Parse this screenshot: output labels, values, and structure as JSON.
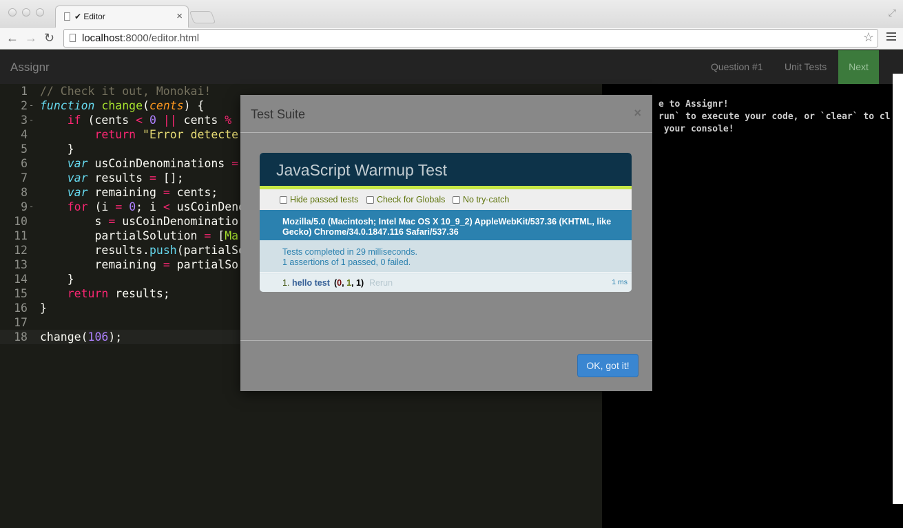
{
  "browser": {
    "tab_title": "✔ Editor",
    "tab_close": "×",
    "url_host": "localhost",
    "url_path": ":8000/editor.html",
    "icons": [
      "back-icon",
      "forward-icon",
      "reload-icon",
      "star-icon",
      "menu-icon"
    ]
  },
  "navbar": {
    "brand": "Assignr",
    "links": [
      "Question #1",
      "Unit Tests"
    ],
    "next_label": "Next"
  },
  "editor": {
    "lines": [
      {
        "n": "1",
        "fold": "",
        "html": "<span class=\"c-comment\">// Check it out, Monokai!</span>"
      },
      {
        "n": "2",
        "fold": "-",
        "html": "<span class=\"c-kw\">function</span> <span class=\"c-fn\">change</span>(<span class=\"c-param\">cents</span>) {"
      },
      {
        "n": "3",
        "fold": "-",
        "html": "    <span class=\"c-ctrl\">if</span> (cents <span class=\"c-op\">&lt;</span> <span class=\"c-num\">0</span> <span class=\"c-op\">||</span> cents <span class=\"c-op\">%</span>"
      },
      {
        "n": "4",
        "fold": "",
        "html": "        <span class=\"c-ctrl\">return</span> <span class=\"c-str\">\"Error detecte</span>"
      },
      {
        "n": "5",
        "fold": "",
        "html": "    }"
      },
      {
        "n": "6",
        "fold": "",
        "html": "    <span class=\"c-kw\">var</span> usCoinDenominations <span class=\"c-op\">=</span>"
      },
      {
        "n": "7",
        "fold": "",
        "html": "    <span class=\"c-kw\">var</span> results <span class=\"c-op\">=</span> [];"
      },
      {
        "n": "8",
        "fold": "",
        "html": "    <span class=\"c-kw\">var</span> remaining <span class=\"c-op\">=</span> cents;"
      },
      {
        "n": "9",
        "fold": "-",
        "html": "    <span class=\"c-ctrl\">for</span> (i <span class=\"c-op\">=</span> <span class=\"c-num\">0</span>; i <span class=\"c-op\">&lt;</span> usCoinDeno"
      },
      {
        "n": "10",
        "fold": "",
        "html": "        s <span class=\"c-op\">=</span> usCoinDenominatio"
      },
      {
        "n": "11",
        "fold": "",
        "html": "        partialSolution <span class=\"c-op\">=</span> [<span class=\"c-fn\">Ma</span>"
      },
      {
        "n": "12",
        "fold": "",
        "html": "        results.<span class=\"c-kw\" style=\"font-style:normal\">push</span>(partialSo"
      },
      {
        "n": "13",
        "fold": "",
        "html": "        remaining <span class=\"c-op\">=</span> partialSo"
      },
      {
        "n": "14",
        "fold": "",
        "html": "    }"
      },
      {
        "n": "15",
        "fold": "",
        "html": "    <span class=\"c-ctrl\">return</span> results;"
      },
      {
        "n": "16",
        "fold": "",
        "html": "}"
      },
      {
        "n": "17",
        "fold": "",
        "html": ""
      },
      {
        "n": "18",
        "fold": "",
        "html": "change(<span class=\"c-num\">106</span>);"
      }
    ]
  },
  "console": {
    "lines": [
      "e to Assignr!",
      "run` to execute your code, or `clear` to cl",
      " your console!"
    ]
  },
  "modal": {
    "title": "Test Suite",
    "close": "×",
    "ok_label": "OK, got it!",
    "qunit": {
      "header": "JavaScript Warmup Test",
      "options": [
        "Hide passed tests",
        "Check for Globals",
        "No try-catch"
      ],
      "user_agent": "Mozilla/5.0 (Macintosh; Intel Mac OS X 10_9_2) AppleWebKit/537.36 (KHTML, like Gecko) Chrome/34.0.1847.116 Safari/537.36",
      "result_line1": "Tests completed in 29 milliseconds.",
      "result_line2": "1 assertions of 1 passed, 0 failed.",
      "test": {
        "number": "1.",
        "name": "hello test",
        "failed": "0",
        "passed": "1",
        "total": "1",
        "rerun": "Rerun",
        "time": "1 ms"
      }
    }
  }
}
